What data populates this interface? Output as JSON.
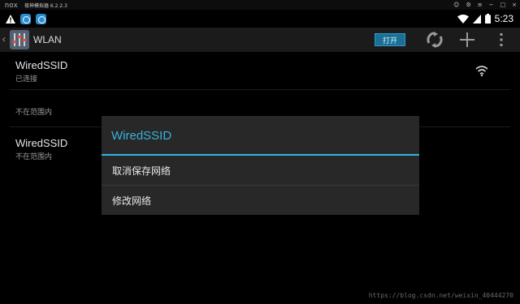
{
  "emulator": {
    "logo": "nox",
    "title": "夜神模拟器 6.2.2.3"
  },
  "status_bar": {
    "time": "5:23"
  },
  "action_bar": {
    "title": "WLAN",
    "toggle_label": "打开"
  },
  "networks": [
    {
      "name": "WiredSSID",
      "status": "已连接"
    },
    {
      "name": "",
      "status": "不在范围内"
    },
    {
      "name": "WiredSSID",
      "status": "不在范围内"
    }
  ],
  "dialog": {
    "title": "WiredSSID",
    "items": [
      "取消保存网络",
      "修改网络"
    ]
  },
  "watermark": "https://blog.csdn.net/weixin_40444270",
  "colors": {
    "accent": "#33b5e5",
    "toggle_bg": "#1b6f95",
    "dialog_bg": "#282828"
  }
}
